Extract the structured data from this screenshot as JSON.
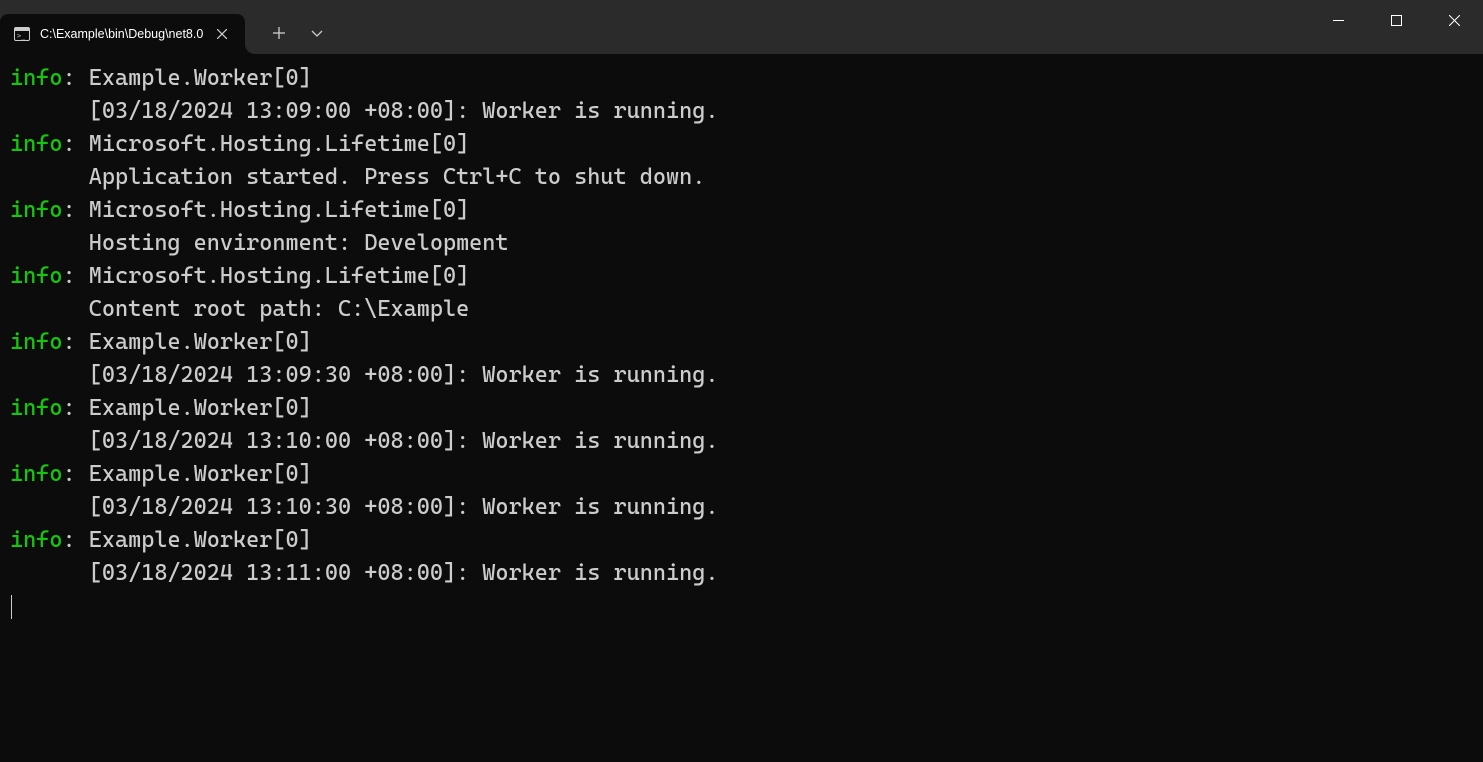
{
  "tab": {
    "title": "C:\\Example\\bin\\Debug\\net8.0"
  },
  "logs": [
    {
      "level": "info",
      "source": "Example.Worker[0]",
      "message": "[03/18/2024 13:09:00 +08:00]: Worker is running."
    },
    {
      "level": "info",
      "source": "Microsoft.Hosting.Lifetime[0]",
      "message": "Application started. Press Ctrl+C to shut down."
    },
    {
      "level": "info",
      "source": "Microsoft.Hosting.Lifetime[0]",
      "message": "Hosting environment: Development"
    },
    {
      "level": "info",
      "source": "Microsoft.Hosting.Lifetime[0]",
      "message": "Content root path: C:\\Example"
    },
    {
      "level": "info",
      "source": "Example.Worker[0]",
      "message": "[03/18/2024 13:09:30 +08:00]: Worker is running."
    },
    {
      "level": "info",
      "source": "Example.Worker[0]",
      "message": "[03/18/2024 13:10:00 +08:00]: Worker is running."
    },
    {
      "level": "info",
      "source": "Example.Worker[0]",
      "message": "[03/18/2024 13:10:30 +08:00]: Worker is running."
    },
    {
      "level": "info",
      "source": "Example.Worker[0]",
      "message": "[03/18/2024 13:11:00 +08:00]: Worker is running."
    }
  ],
  "indent": "      ",
  "separator": ": "
}
